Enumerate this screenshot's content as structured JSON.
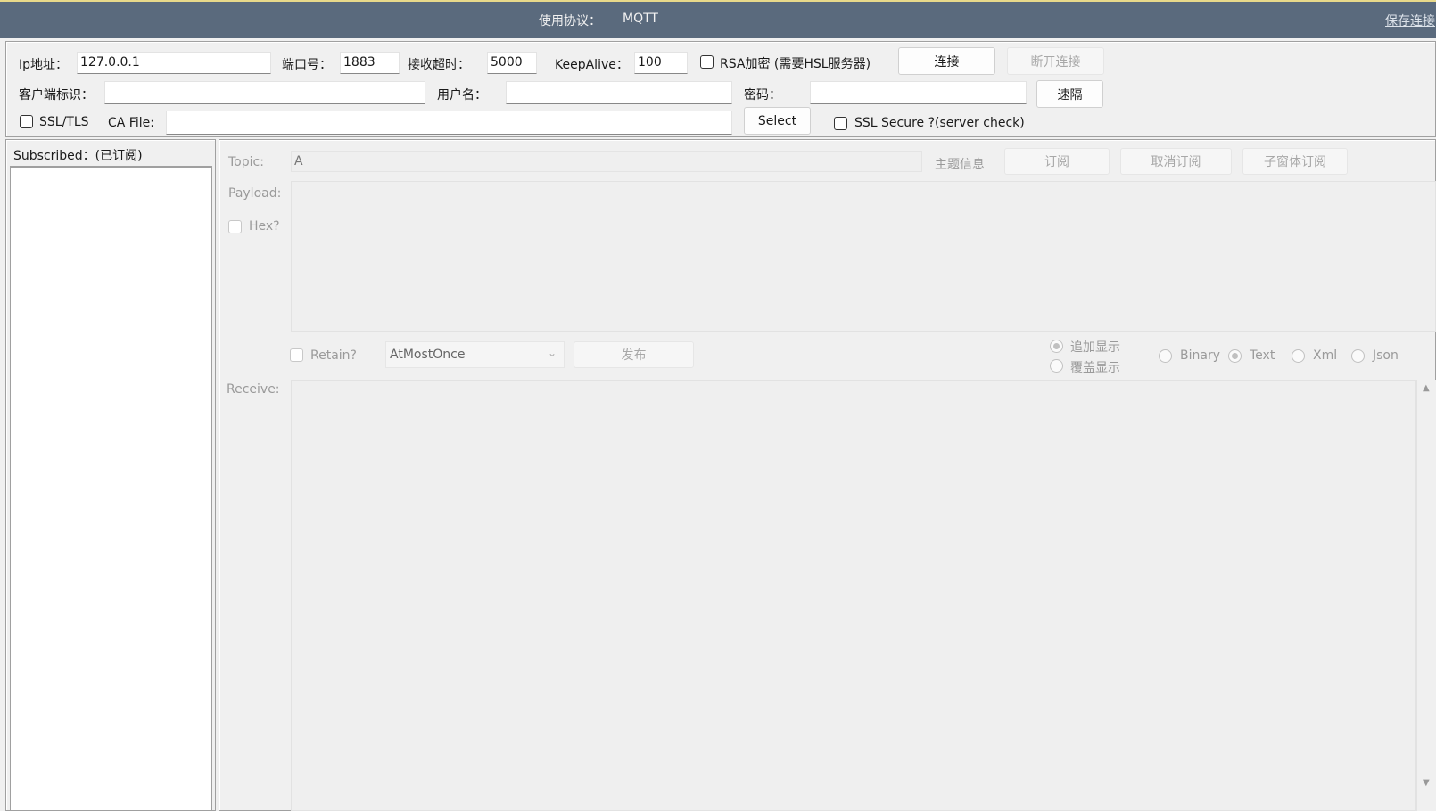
{
  "header": {
    "protocol_label": "使用协议：",
    "protocol_value": "MQTT",
    "save_link": "保存连接"
  },
  "connection": {
    "ip_label": "Ip地址：",
    "ip_value": "127.0.0.1",
    "port_label": "端口号：",
    "port_value": "1883",
    "timeout_label": "接收超时：",
    "timeout_value": "5000",
    "keepalive_label": "KeepAlive：",
    "keepalive_value": "100",
    "rsa_label": "RSA加密 (需要HSL服务器)",
    "rsa_checked": false,
    "connect_button": "连接",
    "disconnect_button": "断开连接",
    "client_id_label": "客户端标识：",
    "client_id_value": "",
    "username_label": "用户名：",
    "username_value": "",
    "password_label": "密码：",
    "password_value": "",
    "extra_button": "速隔",
    "ssl_label": "SSL/TLS",
    "ssl_checked": false,
    "ca_file_label": "CA File:",
    "ca_file_value": "",
    "select_button": "Select",
    "ssl_secure_label": "SSL Secure ?(server check)",
    "ssl_secure_checked": false
  },
  "subscribed": {
    "label": "Subscribed：(已订阅)",
    "items": []
  },
  "publish": {
    "topic_label": "Topic:",
    "topic_value": "A",
    "topic_info_label": "主题信息",
    "subscribe_button": "订阅",
    "unsubscribe_button": "取消订阅",
    "child_subscribe_button": "子窗体订阅",
    "payload_label": "Payload:",
    "payload_value": "",
    "hex_label": "Hex?",
    "retain_label": "Retain?",
    "qos_value": "AtMostOnce",
    "publish_button": "发布",
    "append_label": "追加显示",
    "overwrite_label": "覆盖显示",
    "display_mode": "追加显示",
    "formats": [
      "Binary",
      "Text",
      "Xml",
      "Json"
    ],
    "selected_format": "Text",
    "receive_label": "Receive:",
    "receive_value": ""
  }
}
